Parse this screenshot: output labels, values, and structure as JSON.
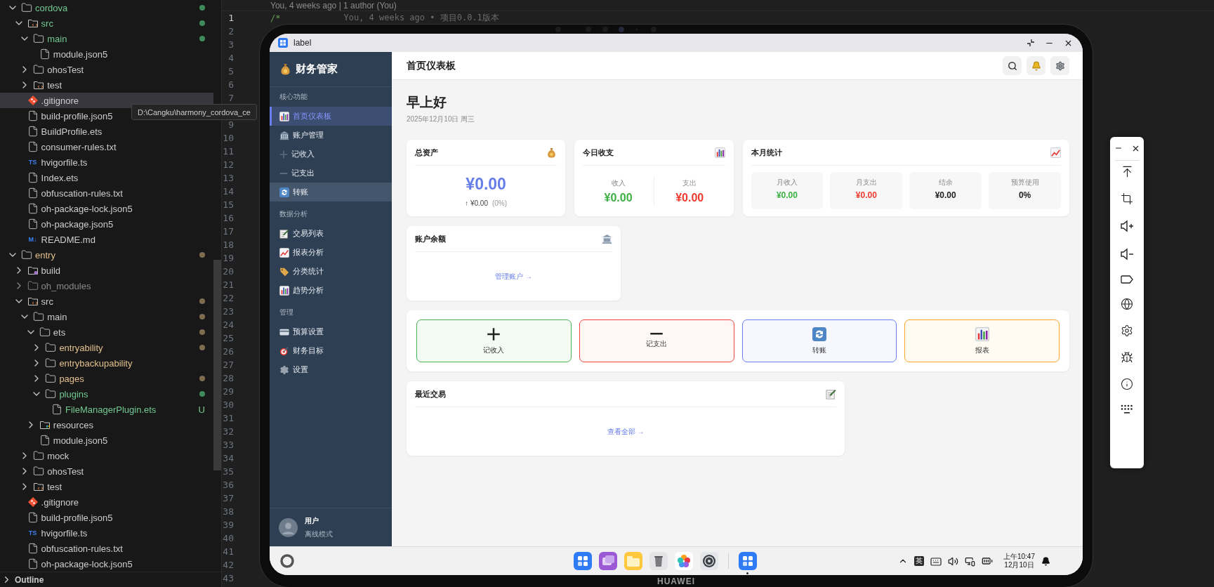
{
  "explorer": {
    "tree": [
      {
        "name": "cordova",
        "kind": "folder",
        "expanded": true,
        "selected": false,
        "added": true,
        "modified": false,
        "ignored": false,
        "color": "#3f8a5a",
        "children": [
          {
            "name": "src",
            "kind": "src-folder",
            "expanded": true,
            "selected": false,
            "added": true,
            "modified": false,
            "ignored": false,
            "color": "#3f8a5a",
            "children": [
              {
                "name": "main",
                "kind": "folder",
                "expanded": true,
                "selected": false,
                "added": true,
                "modified": false,
                "ignored": false,
                "color": "#3f8a5a",
                "children": [
                  {
                    "name": "module.json5",
                    "kind": "file",
                    "selected": false,
                    "added": false,
                    "modified": false,
                    "ignored": false
                  }
                ]
              },
              {
                "name": "ohosTest",
                "kind": "folder",
                "expanded": false,
                "selected": false,
                "added": false,
                "modified": false,
                "ignored": false
              },
              {
                "name": "test",
                "kind": "src-folder",
                "expanded": false,
                "selected": false,
                "added": false,
                "modified": false,
                "ignored": false
              }
            ]
          },
          {
            "name": ".gitignore",
            "kind": "git-file",
            "selected": true,
            "added": false,
            "modified": false,
            "ignored": false
          },
          {
            "name": "build-profile.json5",
            "kind": "file",
            "selected": false,
            "added": false,
            "modified": false,
            "ignored": false
          },
          {
            "name": "BuildProfile.ets",
            "kind": "file",
            "selected": false,
            "added": false,
            "modified": false,
            "ignored": false
          },
          {
            "name": "consumer-rules.txt",
            "kind": "file",
            "selected": false,
            "added": false,
            "modified": false,
            "ignored": false
          },
          {
            "name": "hvigorfile.ts",
            "kind": "ts-file",
            "icon_text": "TS",
            "selected": false,
            "added": false,
            "modified": false,
            "ignored": false
          },
          {
            "name": "Index.ets",
            "kind": "file",
            "selected": false,
            "added": false,
            "modified": false,
            "ignored": false
          },
          {
            "name": "obfuscation-rules.txt",
            "kind": "file",
            "selected": false,
            "added": false,
            "modified": false,
            "ignored": false
          },
          {
            "name": "oh-package-lock.json5",
            "kind": "file",
            "selected": false,
            "added": false,
            "modified": false,
            "ignored": false
          },
          {
            "name": "oh-package.json5",
            "kind": "file",
            "selected": false,
            "added": false,
            "modified": false,
            "ignored": false
          },
          {
            "name": "README.md",
            "kind": "md-file",
            "icon_text": "M↓",
            "selected": false,
            "added": false,
            "modified": false,
            "ignored": false
          }
        ]
      },
      {
        "name": "entry",
        "kind": "folder",
        "expanded": true,
        "selected": false,
        "added": false,
        "modified": true,
        "ignored": false,
        "color": "#7d6c50",
        "children": [
          {
            "name": "build",
            "kind": "build-folder",
            "expanded": false,
            "selected": false,
            "added": false,
            "modified": false,
            "ignored": false
          },
          {
            "name": "oh_modules",
            "kind": "folder",
            "expanded": false,
            "selected": false,
            "added": false,
            "modified": false,
            "ignored": true
          },
          {
            "name": "src",
            "kind": "src-folder",
            "expanded": true,
            "selected": false,
            "added": false,
            "modified": false,
            "ignored": false,
            "color": "#7d6c50",
            "children": [
              {
                "name": "main",
                "kind": "folder",
                "expanded": true,
                "selected": false,
                "added": false,
                "modified": false,
                "ignored": false,
                "color": "#7d6c50",
                "children": [
                  {
                    "name": "ets",
                    "kind": "folder",
                    "expanded": true,
                    "selected": false,
                    "added": false,
                    "modified": false,
                    "ignored": false,
                    "color": "#7d6c50",
                    "children": [
                      {
                        "name": "entryability",
                        "kind": "folder",
                        "expanded": false,
                        "selected": false,
                        "added": false,
                        "modified": true,
                        "ignored": false,
                        "color": "#7d6c50"
                      },
                      {
                        "name": "entrybackupability",
                        "kind": "folder",
                        "expanded": false,
                        "selected": false,
                        "added": false,
                        "modified": true,
                        "ignored": false
                      },
                      {
                        "name": "pages",
                        "kind": "folder",
                        "expanded": false,
                        "selected": false,
                        "added": false,
                        "modified": true,
                        "ignored": false,
                        "color": "#7d6c50"
                      },
                      {
                        "name": "plugins",
                        "kind": "folder",
                        "expanded": true,
                        "selected": false,
                        "added": true,
                        "modified": false,
                        "ignored": false,
                        "color": "#3f8a5a",
                        "children": [
                          {
                            "name": "FileManagerPlugin.ets",
                            "kind": "file",
                            "selected": false,
                            "added": true,
                            "modified": false,
                            "ignored": false,
                            "badge": "U"
                          }
                        ]
                      }
                    ]
                  },
                  {
                    "name": "resources",
                    "kind": "res-folder",
                    "expanded": false,
                    "selected": false,
                    "added": false,
                    "modified": false,
                    "ignored": false
                  },
                  {
                    "name": "module.json5",
                    "kind": "file",
                    "selected": false,
                    "added": false,
                    "modified": false,
                    "ignored": false
                  }
                ]
              },
              {
                "name": "mock",
                "kind": "folder",
                "expanded": false,
                "selected": false,
                "added": false,
                "modified": false,
                "ignored": false
              },
              {
                "name": "ohosTest",
                "kind": "folder",
                "expanded": false,
                "selected": false,
                "added": false,
                "modified": false,
                "ignored": false
              },
              {
                "name": "test",
                "kind": "src-folder",
                "expanded": false,
                "selected": false,
                "added": false,
                "modified": false,
                "ignored": false
              }
            ]
          },
          {
            "name": ".gitignore",
            "kind": "git-file",
            "selected": false,
            "added": false,
            "modified": false,
            "ignored": false
          },
          {
            "name": "build-profile.json5",
            "kind": "file",
            "selected": false,
            "added": false,
            "modified": false,
            "ignored": false
          },
          {
            "name": "hvigorfile.ts",
            "kind": "ts-file",
            "icon_text": "TS",
            "selected": false,
            "added": false,
            "modified": false,
            "ignored": false
          },
          {
            "name": "obfuscation-rules.txt",
            "kind": "file",
            "selected": false,
            "added": false,
            "modified": false,
            "ignored": false
          },
          {
            "name": "oh-package-lock.json5",
            "kind": "file",
            "selected": false,
            "added": false,
            "modified": false,
            "ignored": false
          }
        ]
      }
    ],
    "outline": {
      "label": "Outline",
      "expanded": false
    }
  },
  "tooltip": "D:\\Cangku\\harmony_cordova_ce",
  "editor": {
    "blame_header": "You, 4 weeks ago | 1 author (You)",
    "lines_above_tooltip": [
      {
        "number": "1",
        "current": true,
        "code": "/*",
        "blame": "You, 4 weeks ago • 项目0.0.1版本"
      },
      {
        "number": "2",
        "current": false
      },
      {
        "number": "3",
        "current": false
      },
      {
        "number": "4",
        "current": false
      },
      {
        "number": "5",
        "current": false
      },
      {
        "number": "6",
        "current": false
      },
      {
        "number": "7",
        "current": false
      }
    ],
    "lines_below_tooltip": [
      {
        "number": "9",
        "current": false
      },
      {
        "number": "10",
        "current": false
      },
      {
        "number": "11",
        "current": false
      },
      {
        "number": "12",
        "current": false
      },
      {
        "number": "13",
        "current": false
      },
      {
        "number": "14",
        "current": false
      },
      {
        "number": "15",
        "current": false
      },
      {
        "number": "16",
        "current": false
      },
      {
        "number": "17",
        "current": false
      },
      {
        "number": "18",
        "current": false
      },
      {
        "number": "19",
        "current": false
      },
      {
        "number": "20",
        "current": false
      },
      {
        "number": "21",
        "current": false
      },
      {
        "number": "22",
        "current": false
      },
      {
        "number": "23",
        "current": false
      },
      {
        "number": "24",
        "current": false
      },
      {
        "number": "25",
        "current": false
      },
      {
        "number": "26",
        "current": false
      },
      {
        "number": "27",
        "current": false
      },
      {
        "number": "28",
        "current": false
      },
      {
        "number": "29",
        "current": false
      },
      {
        "number": "30",
        "current": false
      },
      {
        "number": "31",
        "current": false
      },
      {
        "number": "32",
        "current": false
      },
      {
        "number": "33",
        "current": false
      },
      {
        "number": "34",
        "current": false
      },
      {
        "number": "35",
        "current": false
      },
      {
        "number": "36",
        "current": false
      },
      {
        "number": "37",
        "current": false
      },
      {
        "number": "38",
        "current": false
      },
      {
        "number": "39",
        "current": false
      },
      {
        "number": "40",
        "current": false
      },
      {
        "number": "41",
        "current": false
      },
      {
        "number": "42",
        "current": false
      },
      {
        "number": "43",
        "current": false
      }
    ]
  },
  "device": {
    "brand": "HUAWEI",
    "window": {
      "title": "label"
    },
    "app": {
      "brand": "财务管家",
      "nav": [
        {
          "heading": "核心功能",
          "items": [
            {
              "label": "首页仪表板",
              "selected": true,
              "highlighted": false
            },
            {
              "label": "账户管理",
              "selected": false,
              "highlighted": false
            },
            {
              "label": "记收入",
              "selected": false,
              "highlighted": false
            },
            {
              "label": "记支出",
              "selected": false,
              "highlighted": false
            },
            {
              "label": "转账",
              "selected": false,
              "highlighted": true
            }
          ]
        },
        {
          "heading": "数据分析",
          "items": [
            {
              "label": "交易列表",
              "selected": false,
              "highlighted": false
            },
            {
              "label": "报表分析",
              "selected": false,
              "highlighted": false
            },
            {
              "label": "分类统计",
              "selected": false,
              "highlighted": false
            },
            {
              "label": "趋势分析",
              "selected": false,
              "highlighted": false
            }
          ]
        },
        {
          "heading": "管理",
          "items": [
            {
              "label": "预算设置",
              "selected": false,
              "highlighted": false
            },
            {
              "label": "财务目标",
              "selected": false,
              "highlighted": false
            },
            {
              "label": "设置",
              "selected": false,
              "highlighted": false
            }
          ]
        }
      ],
      "user": {
        "name": "用户",
        "status": "离线模式"
      },
      "page_title": "首页仪表板",
      "greeting": "早上好",
      "date": "2025年12月10日 周三",
      "total_assets": {
        "title": "总资产",
        "amount": "¥0.00",
        "change": "↑ ¥0.00",
        "change_percent": "(0%)"
      },
      "today": {
        "title": "今日收支",
        "items": [
          {
            "label": "收入",
            "amount": "¥0.00",
            "kind": "income"
          },
          {
            "label": "支出",
            "amount": "¥0.00",
            "kind": "expense"
          }
        ]
      },
      "month": {
        "title": "本月统计",
        "items": [
          {
            "label": "月收入",
            "value": "¥0.00",
            "kind": "income"
          },
          {
            "label": "月支出",
            "value": "¥0.00",
            "kind": "expense"
          },
          {
            "label": "结余",
            "value": "¥0.00",
            "kind": "neutral"
          },
          {
            "label": "预算使用",
            "value": "0%",
            "kind": "neutral"
          }
        ]
      },
      "accounts": {
        "title": "账户余额",
        "link": "管理账户 →"
      },
      "quick_actions": [
        {
          "label": "记收入",
          "kind": "income"
        },
        {
          "label": "记支出",
          "kind": "expense"
        },
        {
          "label": "转账",
          "kind": "transfer"
        },
        {
          "label": "报表",
          "kind": "report"
        }
      ],
      "recent": {
        "title": "最近交易",
        "link": "查看全部 →"
      }
    },
    "taskbar": {
      "dock": [
        {
          "running": false
        },
        {
          "running": false
        },
        {
          "running": false
        },
        {
          "running": false
        },
        {
          "running": false
        },
        {
          "running": false
        },
        {
          "running": true
        }
      ],
      "input_method": "英",
      "time": "上午10:47",
      "date": "12月10日"
    }
  }
}
